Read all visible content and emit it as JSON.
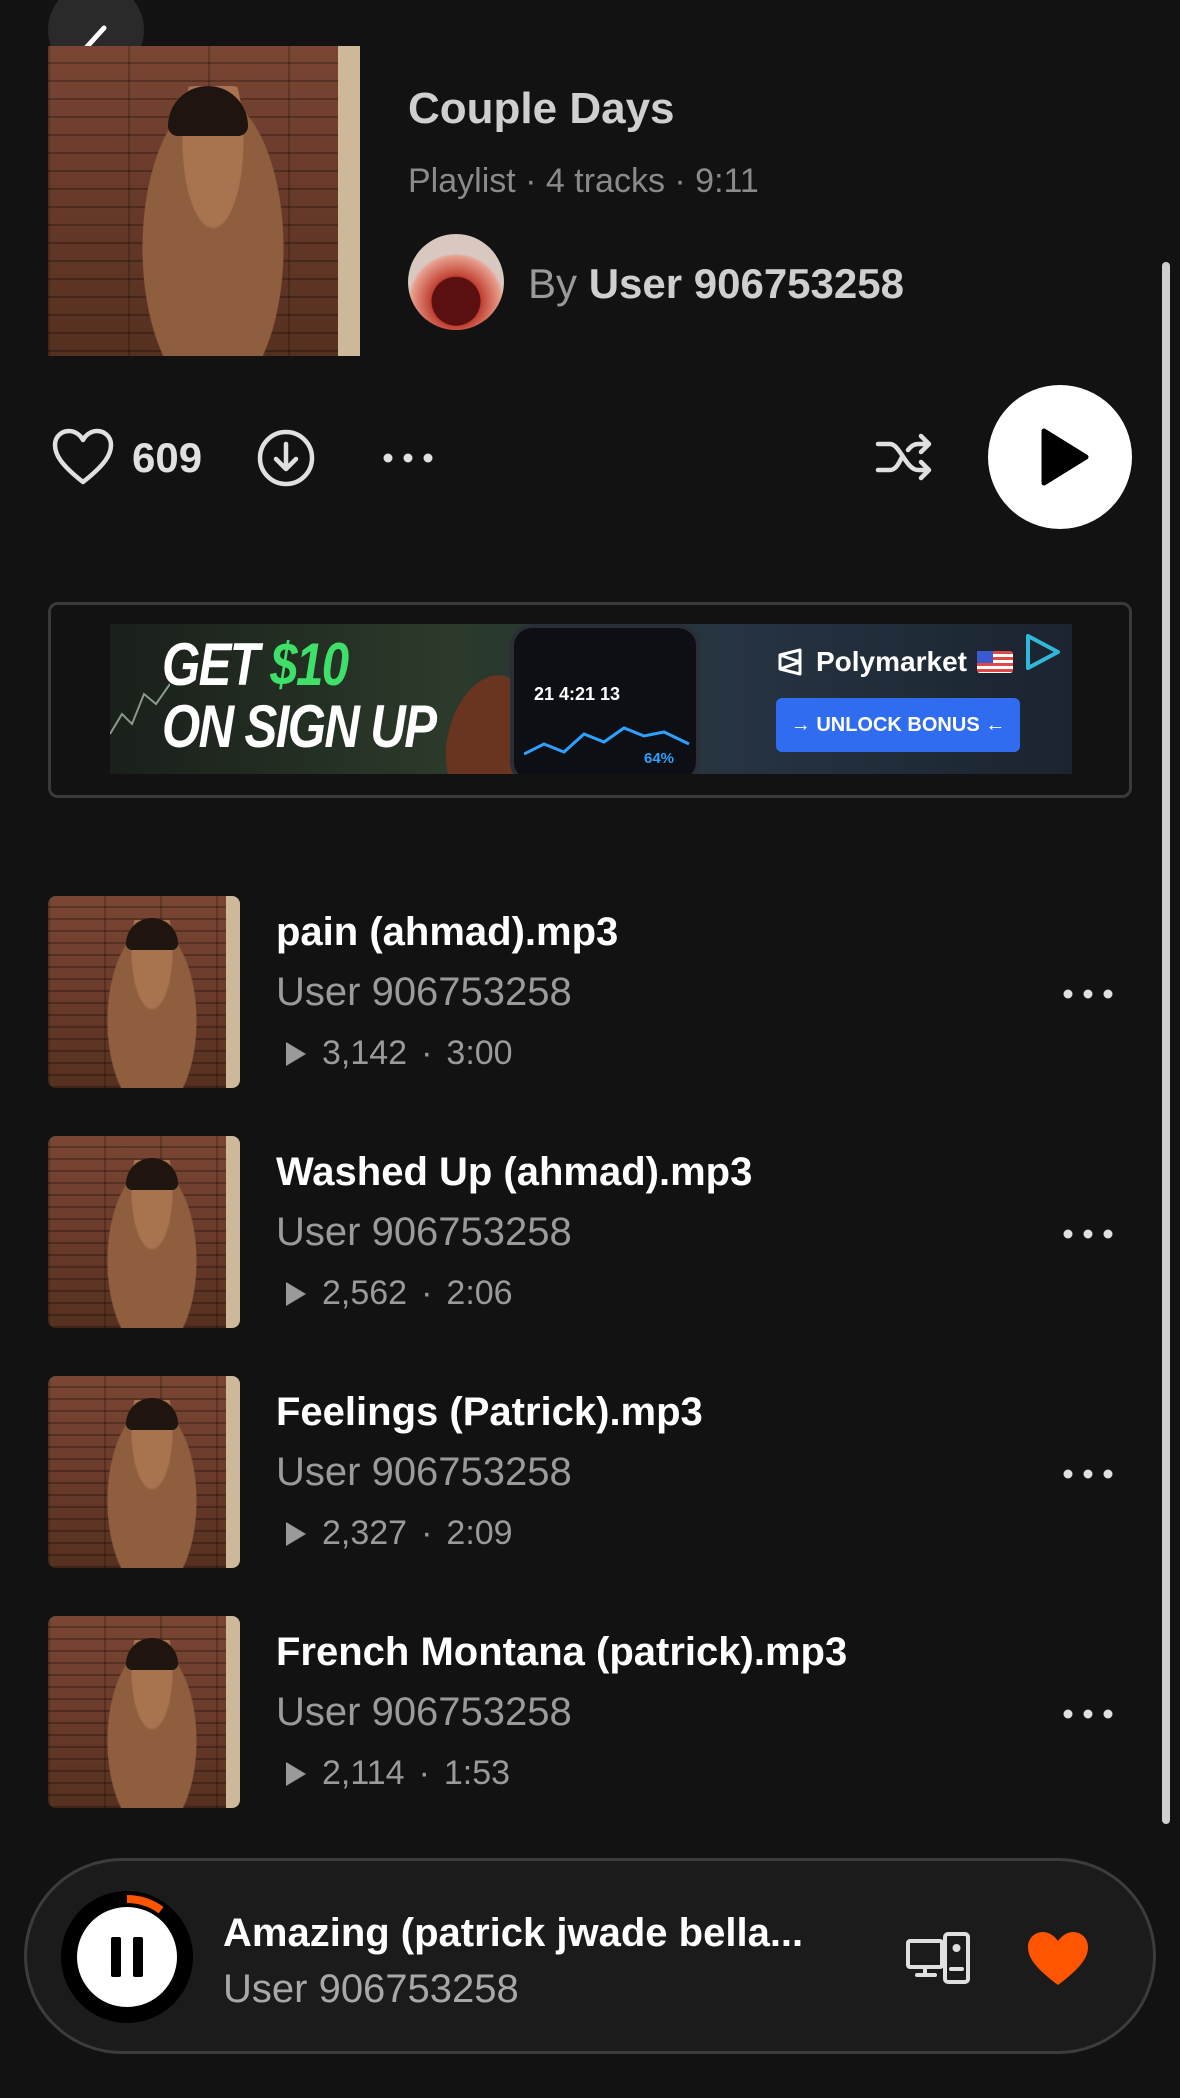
{
  "header": {
    "title": "Couple Days",
    "meta": "Playlist · 4 tracks · 9:11",
    "by_label": "By",
    "owner": "User 906753258"
  },
  "actions": {
    "like_count": "609"
  },
  "ad": {
    "headline_1": "GET",
    "headline_amount": "$10",
    "headline_2": "ON SIGN UP",
    "brand": "Polymarket",
    "cta": "→ UNLOCK BONUS ←",
    "score_line": "21  4:21  13",
    "pct": "64%"
  },
  "tracks": [
    {
      "title": "pain (ahmad).mp3",
      "artist": "User 906753258",
      "plays": "3,142",
      "duration": "3:00"
    },
    {
      "title": "Washed Up (ahmad).mp3",
      "artist": "User 906753258",
      "plays": "2,562",
      "duration": "2:06"
    },
    {
      "title": "Feelings (Patrick).mp3",
      "artist": "User 906753258",
      "plays": "2,327",
      "duration": "2:09"
    },
    {
      "title": "French Montana (patrick).mp3",
      "artist": "User 906753258",
      "plays": "2,114",
      "duration": "1:53"
    }
  ],
  "stat_separator": "·",
  "player": {
    "title": "Amazing (patrick jwade bella...",
    "artist": "User 906753258",
    "progress": 0.1
  },
  "colors": {
    "background": "#121212",
    "accent": "#ff5500"
  }
}
